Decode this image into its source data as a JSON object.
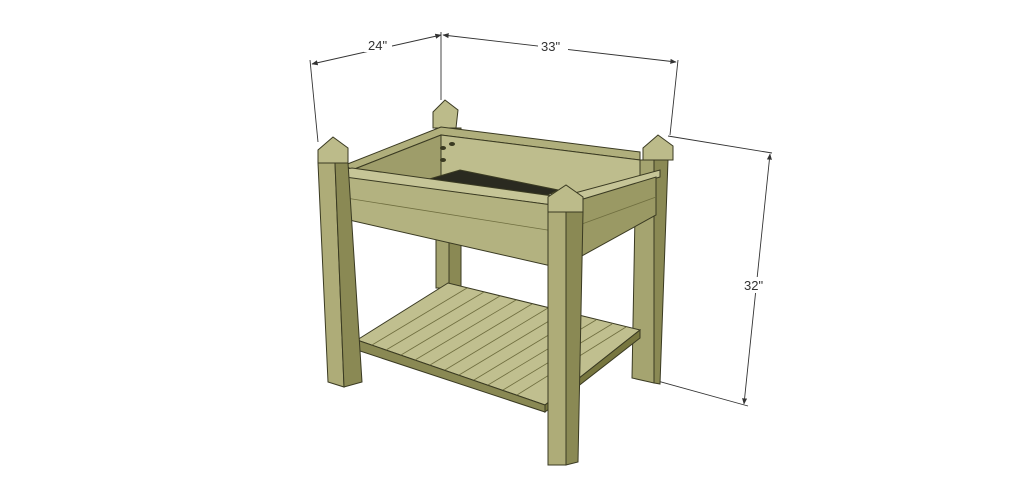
{
  "dimensions": {
    "depth": "24\"",
    "width": "33\"",
    "height": "32\""
  },
  "colors": {
    "wood_light": "#bcbb8a",
    "wood_mid": "#a5a470",
    "wood_dark": "#8a8954",
    "wood_shadow": "#6f6e3f",
    "outline": "#3a3a22",
    "mesh": "#2a2a20",
    "dimension_line": "#333333"
  }
}
